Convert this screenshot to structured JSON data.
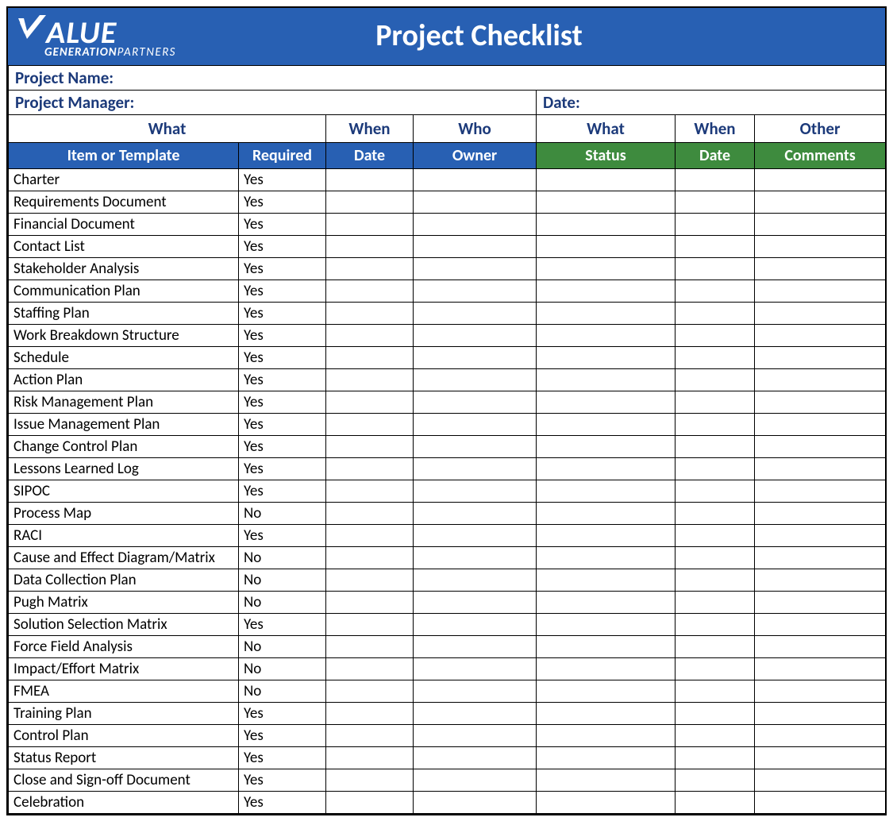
{
  "logo": {
    "word": "ALUE",
    "sub_bold": "GENERATION",
    "sub_ital": "PARTNERS"
  },
  "title": "Project Checklist",
  "meta": {
    "project_name_label": "Project Name:",
    "project_manager_label": "Project Manager:",
    "date_label": "Date:"
  },
  "group_headers": {
    "what1": "What",
    "when1": "When",
    "who": "Who",
    "what2": "What",
    "when2": "When",
    "other": "Other"
  },
  "col_headers": {
    "item": "Item or Template",
    "required": "Required",
    "date1": "Date",
    "owner": "Owner",
    "status": "Status",
    "date2": "Date",
    "comments": "Comments"
  },
  "rows": [
    {
      "item": "Charter",
      "required": "Yes"
    },
    {
      "item": "Requirements Document",
      "required": "Yes"
    },
    {
      "item": "Financial Document",
      "required": "Yes"
    },
    {
      "item": "Contact List",
      "required": "Yes"
    },
    {
      "item": "Stakeholder Analysis",
      "required": "Yes"
    },
    {
      "item": "Communication Plan",
      "required": "Yes"
    },
    {
      "item": "Staffing Plan",
      "required": "Yes"
    },
    {
      "item": "Work Breakdown Structure",
      "required": "Yes"
    },
    {
      "item": "Schedule",
      "required": "Yes"
    },
    {
      "item": "Action Plan",
      "required": "Yes"
    },
    {
      "item": "Risk Management Plan",
      "required": "Yes"
    },
    {
      "item": "Issue Management Plan",
      "required": "Yes"
    },
    {
      "item": "Change Control Plan",
      "required": "Yes"
    },
    {
      "item": "Lessons Learned Log",
      "required": "Yes"
    },
    {
      "item": "SIPOC",
      "required": "Yes"
    },
    {
      "item": "Process Map",
      "required": "No"
    },
    {
      "item": "RACI",
      "required": "Yes"
    },
    {
      "item": "Cause and Effect Diagram/Matrix",
      "required": "No"
    },
    {
      "item": "Data Collection Plan",
      "required": "No"
    },
    {
      "item": "Pugh Matrix",
      "required": "No"
    },
    {
      "item": "Solution Selection Matrix",
      "required": "Yes"
    },
    {
      "item": "Force Field Analysis",
      "required": "No"
    },
    {
      "item": "Impact/Effort Matrix",
      "required": "No"
    },
    {
      "item": "FMEA",
      "required": "No"
    },
    {
      "item": "Training Plan",
      "required": "Yes"
    },
    {
      "item": "Control Plan",
      "required": "Yes"
    },
    {
      "item": "Status Report",
      "required": "Yes"
    },
    {
      "item": "Close and Sign-off Document",
      "required": "Yes"
    },
    {
      "item": "Celebration",
      "required": "Yes"
    }
  ]
}
